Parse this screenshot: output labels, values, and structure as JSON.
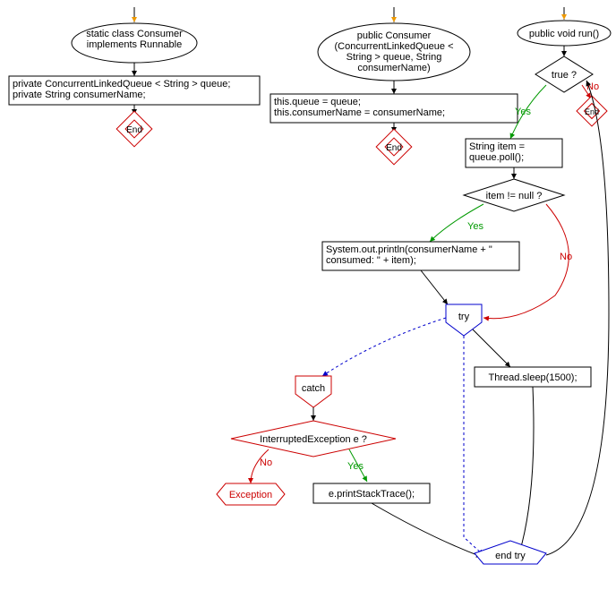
{
  "flowchart1": {
    "start": "static class Consumer implements Runnable",
    "body": "private ConcurrentLinkedQueue < String > queue;\nprivate String consumerName;",
    "end": "End"
  },
  "flowchart2": {
    "start": "public Consumer (ConcurrentLinkedQueue < String > queue, String consumerName)",
    "body": "this.queue = queue;\nthis.consumerName = consumerName;",
    "end": "End"
  },
  "flowchart3": {
    "start": "public void run()",
    "loop_condition": "true ?",
    "loop_yes": "Yes",
    "loop_no": "No",
    "end": "End",
    "stmt1": "String item = queue.poll();",
    "if_condition": "item != null ?",
    "if_yes": "Yes",
    "if_no": "No",
    "stmt2": "System.out.println(consumerName + \" consumed: \" + item);",
    "try_label": "try",
    "stmt3": "Thread.sleep(1500);",
    "catch_label": "catch",
    "catch_condition": "InterruptedException e ?",
    "catch_yes": "Yes",
    "catch_no": "No",
    "exception": "Exception",
    "stmt4": "e.printStackTrace();",
    "endtry": "end try"
  }
}
